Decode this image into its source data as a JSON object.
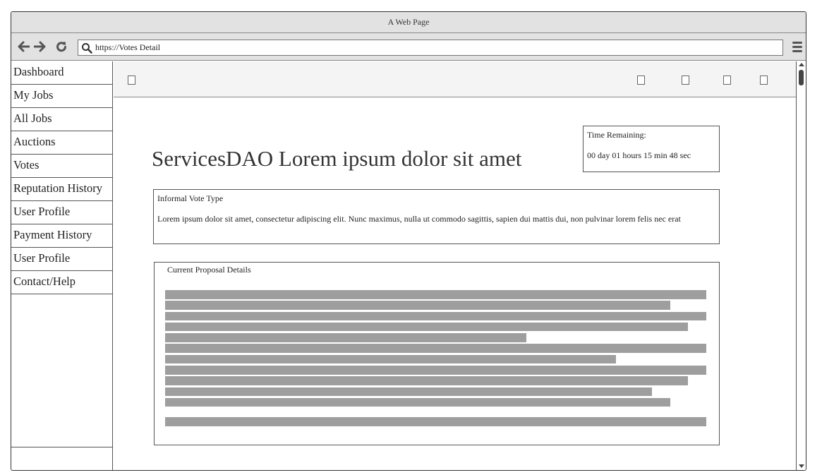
{
  "window": {
    "title": "A Web Page"
  },
  "toolbar": {
    "back_icon": "arrow-left-icon",
    "forward_icon": "arrow-right-icon",
    "reload_icon": "reload-icon",
    "url": "https://Votes Detail",
    "menu_icon": "hamburger-menu-icon"
  },
  "sidebar": {
    "items": [
      {
        "label": "Dashboard"
      },
      {
        "label": "My Jobs"
      },
      {
        "label": "All Jobs"
      },
      {
        "label": "Auctions"
      },
      {
        "label": "Votes"
      },
      {
        "label": "Reputation History"
      },
      {
        "label": "User Profile"
      },
      {
        "label": "Payment History"
      },
      {
        "label": "User Profile"
      },
      {
        "label": "Contact/Help"
      }
    ]
  },
  "main": {
    "title": "ServicesDAO Lorem ipsum dolor sit amet",
    "timer": {
      "label": "Time Remaining:",
      "value": "00 day 01 hours 15 min 48 sec"
    },
    "vote": {
      "type": "Informal Vote Type",
      "description": "Lorem ipsum dolor sit amet, consectetur adipiscing elit. Nunc maximus, nulla ut commodo sagittis, sapien dui mattis dui, non pulvinar lorem felis nec erat"
    },
    "proposal": {
      "title": "Current Proposal Details"
    }
  },
  "colors": {
    "chrome": "#e2e2e2",
    "placeholder_line": "#9e9e9e",
    "border": "#555555"
  }
}
